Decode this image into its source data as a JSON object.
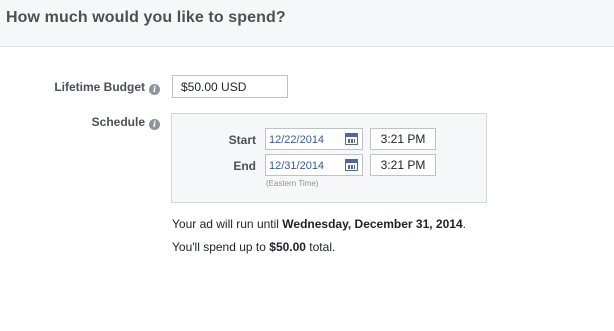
{
  "header": {
    "title": "How much would you like to spend?"
  },
  "budget": {
    "label": "Lifetime Budget",
    "value": "$50.00 USD"
  },
  "schedule": {
    "label": "Schedule",
    "start": {
      "label": "Start",
      "date": "12/22/2014",
      "time": "3:21 PM"
    },
    "end": {
      "label": "End",
      "date": "12/31/2014",
      "time": "3:21 PM"
    },
    "timezone": "(Eastern Time)"
  },
  "summary": {
    "run_prefix": "Your ad will run until ",
    "run_date": "Wednesday, December 31, 2014",
    "run_suffix": ".",
    "spend_prefix": "You'll spend up to ",
    "spend_amount": "$50.00",
    "spend_suffix": " total."
  },
  "icons": {
    "info": "info-icon",
    "calendar": "calendar-icon"
  },
  "colors": {
    "header_bg": "#f6f7f9",
    "link": "#365899",
    "label": "#4b4f56"
  }
}
